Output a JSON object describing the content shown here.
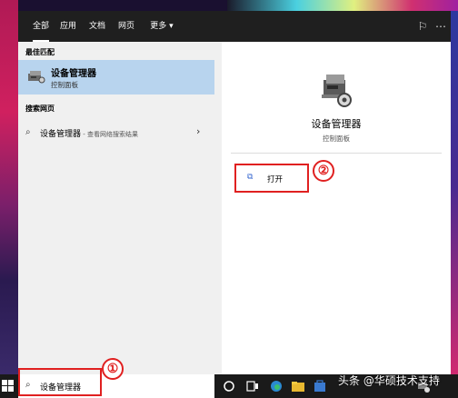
{
  "tabs": [
    "全部",
    "应用",
    "文档",
    "网页",
    "更多 ▾"
  ],
  "topbar_icons": [
    "feedback-icon",
    "more-icon"
  ],
  "left": {
    "best_match_title": "最佳匹配",
    "best_match_name": "设备管理器",
    "best_match_sub": "控制面板",
    "web_title": "搜索网页",
    "web_query": "设备管理器",
    "web_sub": " - 查看网络搜索结果",
    "web_chevron": "›"
  },
  "right": {
    "app_name": "设备管理器",
    "app_sub": "控制面板",
    "open_label": "打开"
  },
  "annotations": {
    "badge1": "①",
    "badge2": "②"
  },
  "taskbar": {
    "search_value": "设备管理器",
    "watermark": "头条 @华硕技术支持"
  },
  "colors": {
    "accent": "#e02020",
    "selection": "#b8d4ee",
    "topbar": "#1f1f1f"
  }
}
